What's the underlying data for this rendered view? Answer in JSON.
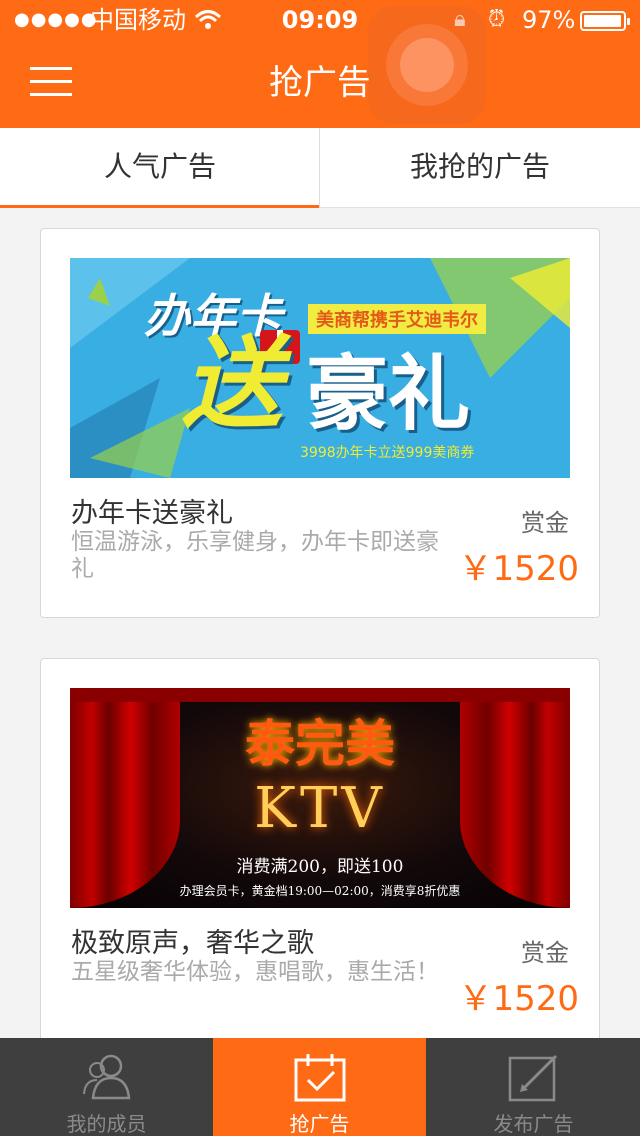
{
  "status_bar": {
    "signal": "●●●●●",
    "carrier": "中国移动",
    "wifi_icon": "wifi-icon",
    "time": "09:09",
    "battery": "97%",
    "battery_level": 0.97
  },
  "nav": {
    "title": "抢广告",
    "menu_icon": "hamburger-menu-icon"
  },
  "tabs": [
    {
      "label": "人气广告",
      "active": true
    },
    {
      "label": "我抢的广告",
      "active": false
    }
  ],
  "ads": [
    {
      "banner": {
        "headline": "办年卡",
        "tag": "美商帮携手艾迪韦尔",
        "big1": "送",
        "big2": "豪礼",
        "footer": "3998办年卡立送999美商券"
      },
      "title": "办年卡送豪礼",
      "description": "恒温游泳，乐享健身，办年卡即送豪礼",
      "reward_label": "赏金",
      "reward": "￥1520"
    },
    {
      "banner": {
        "name": "泰完美",
        "ktv": "KTV",
        "promo": "消费满200，即送100",
        "sub": "办理会员卡，黄金档19:00—02:00，消费享8折优惠"
      },
      "title": "极致原声，奢华之歌",
      "description": "五星级奢华体验，惠唱歌，惠生活！",
      "reward_label": "赏金",
      "reward": "￥1520"
    }
  ],
  "tabbar": [
    {
      "label": "我的成员",
      "icon": "members-icon",
      "active": false
    },
    {
      "label": "抢广告",
      "icon": "grab-ad-icon",
      "active": true
    },
    {
      "label": "发布广告",
      "icon": "publish-ad-icon",
      "active": false
    }
  ],
  "colors": {
    "accent": "#ff6a14",
    "tabbar_bg": "#3f3f3f"
  }
}
